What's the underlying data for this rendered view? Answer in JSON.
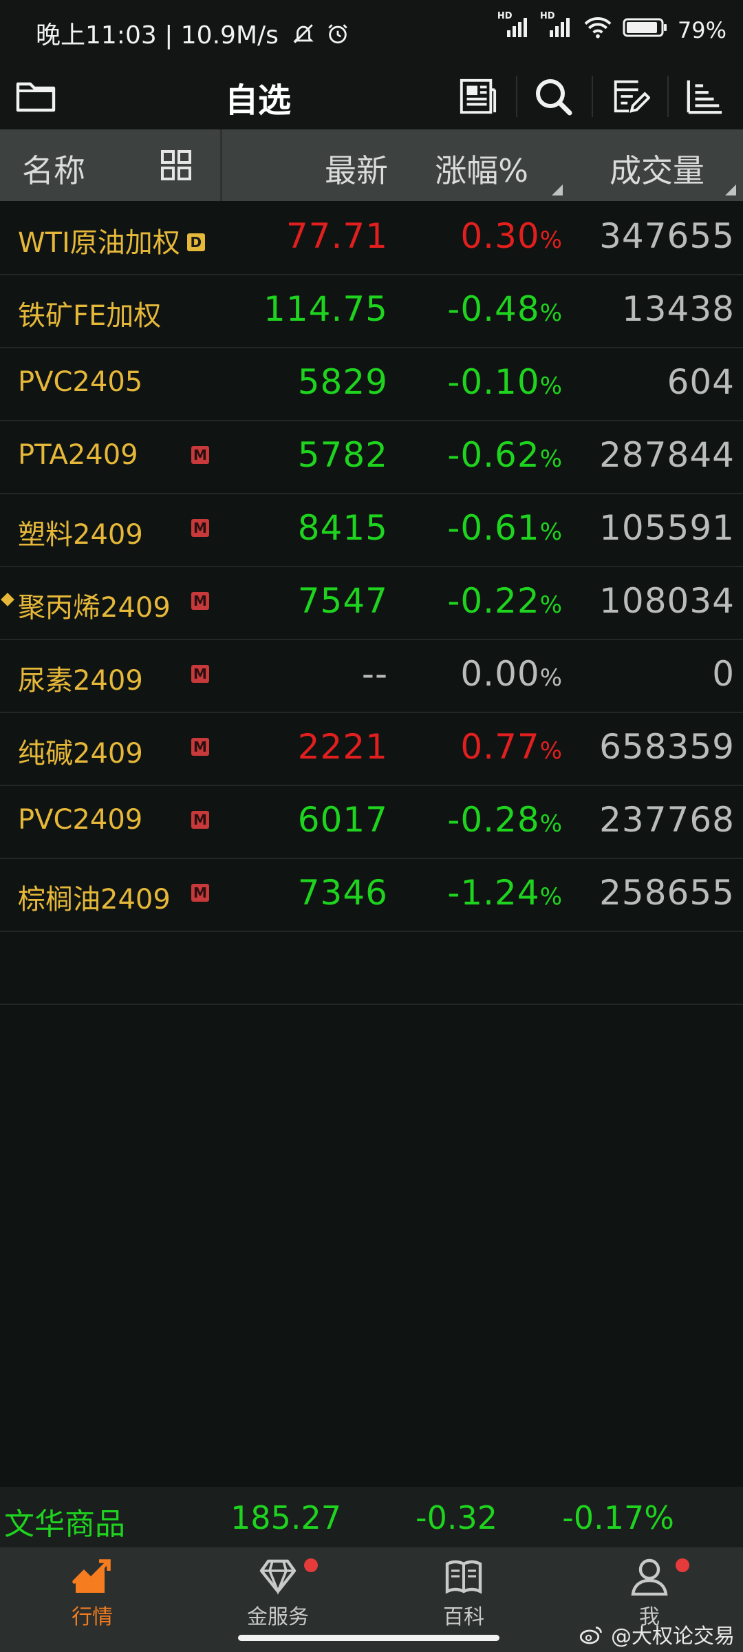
{
  "status_bar": {
    "time": "晚上11:03",
    "net_speed": "10.9M/s",
    "signal_tag": "HD",
    "battery": "79%"
  },
  "topbar": {
    "title": "自选"
  },
  "header": {
    "name_col": "名称",
    "latest_col": "最新",
    "change_col": "涨幅%",
    "volume_col": "成交量"
  },
  "rows": [
    {
      "name": "WTI原油加权",
      "badge": "D",
      "price": "77.71",
      "pct": "0.30",
      "pct_unit": "%",
      "volume": "347655",
      "trend": "up",
      "marked": false
    },
    {
      "name": "铁矿FE加权",
      "badge": "",
      "price": "114.75",
      "pct": "-0.48",
      "pct_unit": "%",
      "volume": "13438",
      "trend": "down",
      "marked": false
    },
    {
      "name": "PVC2405",
      "badge": "",
      "price": "5829",
      "pct": "-0.10",
      "pct_unit": "%",
      "volume": "604",
      "trend": "down",
      "marked": false
    },
    {
      "name": "PTA2409",
      "badge": "M",
      "price": "5782",
      "pct": "-0.62",
      "pct_unit": "%",
      "volume": "287844",
      "trend": "down",
      "marked": false
    },
    {
      "name": "塑料2409",
      "badge": "M",
      "price": "8415",
      "pct": "-0.61",
      "pct_unit": "%",
      "volume": "105591",
      "trend": "down",
      "marked": false
    },
    {
      "name": "聚丙烯2409",
      "badge": "M",
      "price": "7547",
      "pct": "-0.22",
      "pct_unit": "%",
      "volume": "108034",
      "trend": "down",
      "marked": true
    },
    {
      "name": "尿素2409",
      "badge": "M",
      "price": "--",
      "pct": "0.00",
      "pct_unit": "%",
      "volume": "0",
      "trend": "flat",
      "marked": false
    },
    {
      "name": "纯碱2409",
      "badge": "M",
      "price": "2221",
      "pct": "0.77",
      "pct_unit": "%",
      "volume": "658359",
      "trend": "up",
      "marked": false
    },
    {
      "name": "PVC2409",
      "badge": "M",
      "price": "6017",
      "pct": "-0.28",
      "pct_unit": "%",
      "volume": "237768",
      "trend": "down",
      "marked": false
    },
    {
      "name": "棕榈油2409",
      "badge": "M",
      "price": "7346",
      "pct": "-1.24",
      "pct_unit": "%",
      "volume": "258655",
      "trend": "down",
      "marked": false
    }
  ],
  "ticker": {
    "name": "文华商品",
    "value": "185.27",
    "change": "-0.32",
    "change_pct": "-0.17%"
  },
  "bottom_nav": {
    "items": [
      {
        "label": "行情",
        "icon": "chart-trend-icon",
        "active": true,
        "dot": false
      },
      {
        "label": "金服务",
        "icon": "diamond-icon",
        "active": false,
        "dot": true
      },
      {
        "label": "百科",
        "icon": "book-icon",
        "active": false,
        "dot": false
      },
      {
        "label": "我",
        "icon": "user-icon",
        "active": false,
        "dot": true
      }
    ]
  },
  "watermark": "@大权论交易",
  "colors": {
    "up": "#e11f1f",
    "down": "#1ed41e",
    "name": "#e6b83a",
    "active_tab": "#f57c1f",
    "background": "#0f1311"
  }
}
